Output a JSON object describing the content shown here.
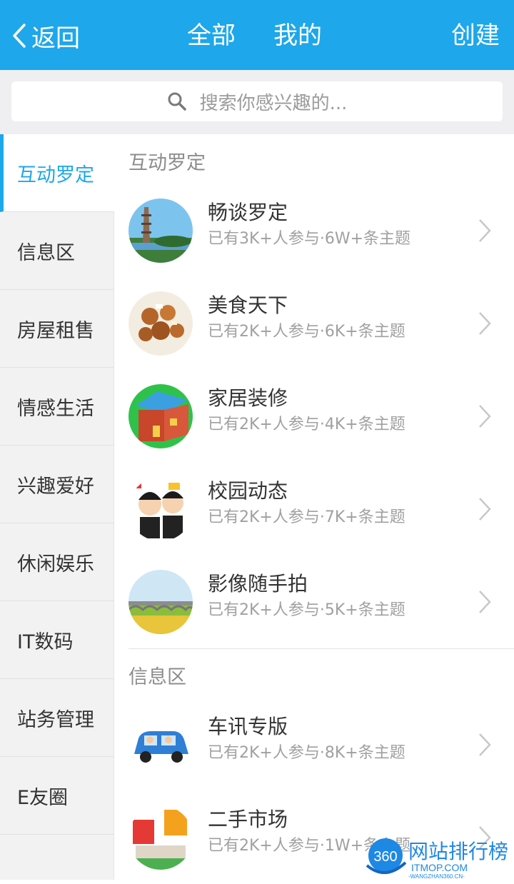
{
  "header": {
    "back_label": "返回",
    "tab_all": "全部",
    "tab_mine": "我的",
    "create_label": "创建",
    "bg_color": "#1ea7ea"
  },
  "search": {
    "placeholder": "搜索你感兴趣的..."
  },
  "sidebar": {
    "items": [
      {
        "label": "互动罗定",
        "active": true
      },
      {
        "label": "信息区"
      },
      {
        "label": "房屋租售"
      },
      {
        "label": "情感生活"
      },
      {
        "label": "兴趣爱好"
      },
      {
        "label": "休闲娱乐"
      },
      {
        "label": "IT数码"
      },
      {
        "label": "站务管理"
      },
      {
        "label": "E友圈"
      }
    ],
    "accent": "#1ea7ea"
  },
  "sections": [
    {
      "title": "互动罗定",
      "items": [
        {
          "title": "畅谈罗定",
          "sub": "已有3K+人参与·6W+条主题",
          "icon": "pagoda-photo"
        },
        {
          "title": "美食天下",
          "sub": "已有2K+人参与·6K+条主题",
          "icon": "food-photo"
        },
        {
          "title": "家居装修",
          "sub": "已有2K+人参与·4K+条主题",
          "icon": "house-icon"
        },
        {
          "title": "校园动态",
          "sub": "已有2K+人参与·7K+条主题",
          "icon": "students-icon"
        },
        {
          "title": "影像随手拍",
          "sub": "已有2K+人参与·5K+条主题",
          "icon": "bridge-photo"
        }
      ]
    },
    {
      "title": "信息区",
      "items": [
        {
          "title": "车讯专版",
          "sub": "已有2K+人参与·8K+条主题",
          "icon": "car-icon"
        },
        {
          "title": "二手市场",
          "sub": "已有2K+人参与·1W+条主题",
          "icon": "market-icon"
        }
      ]
    }
  ],
  "watermark": {
    "badge": "360",
    "text": "网站排行榜",
    "brand": "ITMOP.COM",
    "url": "-WANGZHAN360.CN-"
  }
}
